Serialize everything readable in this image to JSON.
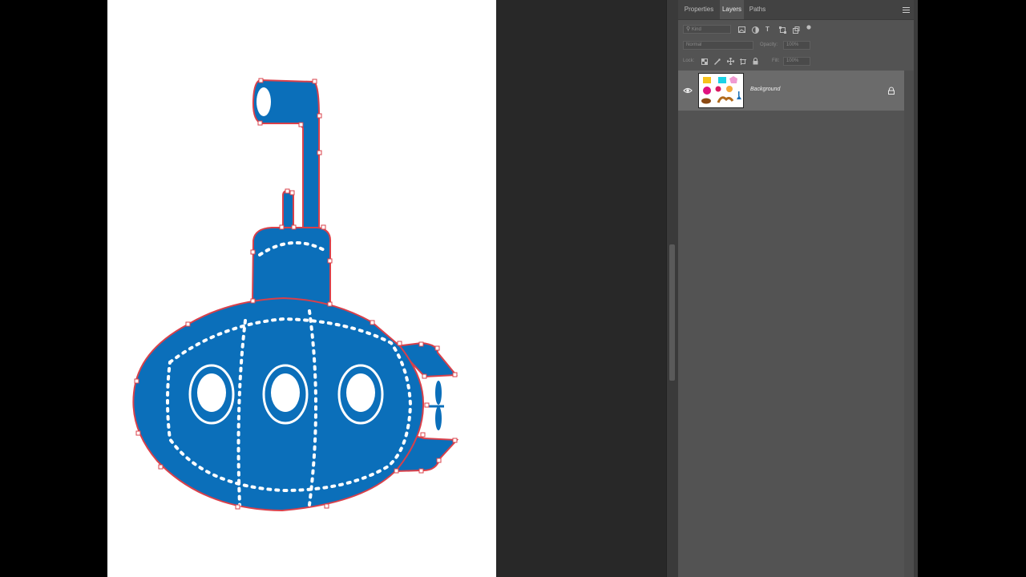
{
  "panel": {
    "tabs": [
      {
        "label": "Properties"
      },
      {
        "label": "Layers"
      },
      {
        "label": "Paths"
      }
    ],
    "filter": {
      "label": "Kind"
    },
    "blend_mode": {
      "value": "Normal"
    },
    "opacity": {
      "label": "Opacity:",
      "value": "100%"
    },
    "lock": {
      "label": "Lock:"
    },
    "fill": {
      "label": "Fill:",
      "value": "100%"
    },
    "layers": [
      {
        "name": "Background",
        "visible": true,
        "locked": true
      }
    ]
  },
  "colors": {
    "submarine_fill": "#0b6fba",
    "selection_outline": "#d9404a",
    "porthole": "#ffffff",
    "panel_bg": "#535353",
    "selected_layer_bg": "#6b6b6b"
  }
}
